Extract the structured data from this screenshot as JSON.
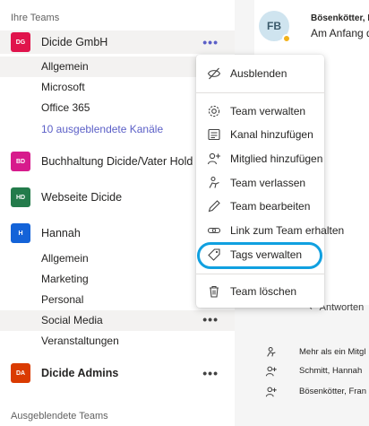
{
  "sidebar": {
    "section_your_teams": "Ihre Teams",
    "section_hidden_teams": "Ausgeblendete Teams",
    "teams": [
      {
        "initials": "DG",
        "name": "Dicide GmbH",
        "color": "#e0144c",
        "channels": [
          "Allgemein",
          "Microsoft",
          "Office 365"
        ],
        "hidden_link": "10 ausgeblendete Kanäle"
      },
      {
        "initials": "BD",
        "name": "Buchhaltung Dicide/Vater Holdi...",
        "color": "#d71b8c"
      },
      {
        "initials": "HD",
        "name": "Webseite Dicide",
        "color": "#237b4b"
      },
      {
        "initials": "H",
        "name": "Hannah",
        "color": "#1463d8",
        "channels": [
          "Allgemein",
          "Marketing",
          "Personal",
          "Social Media",
          "Veranstaltungen"
        ]
      },
      {
        "initials": "DA",
        "name": "Dicide Admins",
        "color": "#da3b01"
      }
    ]
  },
  "chat": {
    "avatar_initials": "FB",
    "sender": "Bösenkötter, F",
    "message": "Am Anfang d",
    "reply_label": "Antworten",
    "activities": [
      "Mehr als ein Mitgl",
      "Schmitt, Hannah",
      "Bösenkötter, Fran"
    ]
  },
  "menu": {
    "items": [
      {
        "label": "Ausblenden",
        "icon": "eye-off-icon"
      },
      {
        "label": "Team verwalten",
        "icon": "gear-icon"
      },
      {
        "label": "Kanal hinzufügen",
        "icon": "add-channel-icon"
      },
      {
        "label": "Mitglied hinzufügen",
        "icon": "add-person-icon"
      },
      {
        "label": "Team verlassen",
        "icon": "leave-icon"
      },
      {
        "label": "Team bearbeiten",
        "icon": "pencil-icon"
      },
      {
        "label": "Link zum Team erhalten",
        "icon": "link-icon"
      },
      {
        "label": "Tags verwalten",
        "icon": "tag-icon"
      },
      {
        "label": "Team löschen",
        "icon": "trash-icon"
      }
    ]
  },
  "colors": {
    "accent": "#5b5fc7",
    "highlight_ring": "#10a0e0"
  }
}
